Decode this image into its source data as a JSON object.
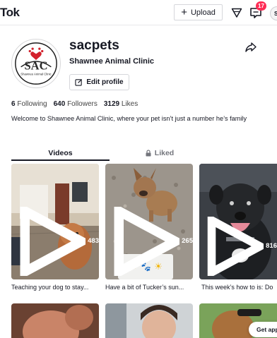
{
  "topbar": {
    "logo_text": "Tok",
    "upload_label": "Upload",
    "inbox_badge": "17",
    "user_avatar_initial": "S"
  },
  "profile": {
    "username": "sacpets",
    "display_name": "Shawnee Animal Clinic",
    "edit_button_label": "Edit profile",
    "avatar_logo_text": "SAC",
    "avatar_logo_subtext": "Shawnee Animal Clinic",
    "stats": {
      "following_count": "6",
      "following_label": "Following",
      "followers_count": "640",
      "followers_label": "Followers",
      "likes_count": "3129",
      "likes_label": "Likes"
    },
    "bio": "Welcome to Shawnee Animal Clinic, where your pet isn’t just a number he’s family"
  },
  "tabs": [
    {
      "label": "Videos",
      "active": true
    },
    {
      "label": "Liked",
      "active": false,
      "icon": "lock-icon"
    }
  ],
  "videos": [
    {
      "views": "483",
      "caption": "Teaching your dog to stay..."
    },
    {
      "views": "265",
      "caption": "Have a bit of Tucker’s sun..."
    },
    {
      "views": "816",
      "caption": "This week’s how to is: Do"
    }
  ],
  "get_app_label": "Get app",
  "colors": {
    "accent": "#fe2c55",
    "text": "#161823",
    "muted": "#73757c",
    "border": "#d6d7db"
  }
}
